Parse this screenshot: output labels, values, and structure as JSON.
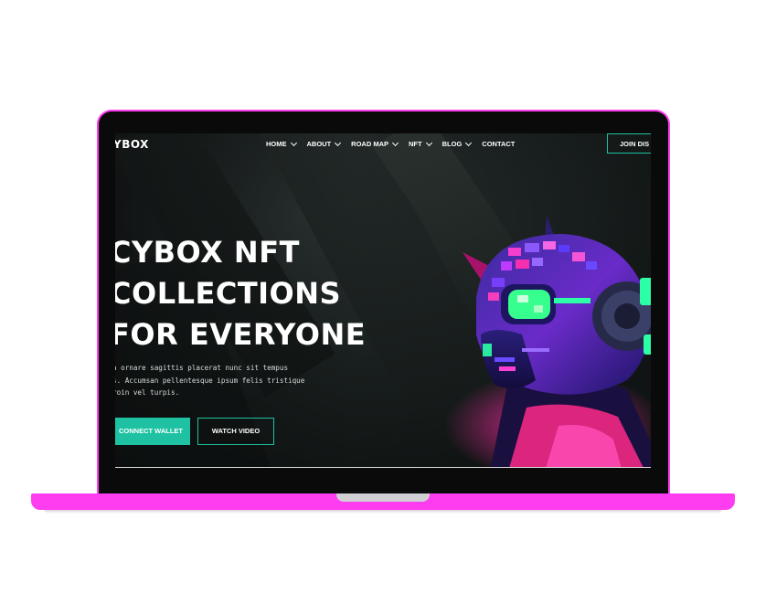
{
  "site": {
    "logo": "YBOX",
    "nav": [
      {
        "label": "HOME",
        "dropdown": true
      },
      {
        "label": "ABOUT",
        "dropdown": true
      },
      {
        "label": "ROAD MAP",
        "dropdown": true
      },
      {
        "label": "NFT",
        "dropdown": true
      },
      {
        "label": "BLOG",
        "dropdown": true
      },
      {
        "label": "CONTACT",
        "dropdown": false
      }
    ],
    "join_label": "JOIN DIS"
  },
  "hero": {
    "title_lines": [
      "CYBOX NFT",
      "COLLECTIONS",
      "FOR EVERYONE"
    ],
    "description_lines": [
      "a ornare sagittis placerat nunc sit tempus",
      "s. Accumsan pellentesque ipsum felis tristique",
      "roin vel turpis."
    ],
    "primary_button": "CONNECT WALLET",
    "secondary_button": "WATCH VIDEO"
  },
  "colors": {
    "accent": "#1ec2a2",
    "device": "#ff3df0",
    "background": "#151b1a",
    "text": "#ffffff"
  },
  "icons": {
    "dropdown": "chevron-down-icon",
    "hero_art": "cyber-robot-head-illustration"
  }
}
